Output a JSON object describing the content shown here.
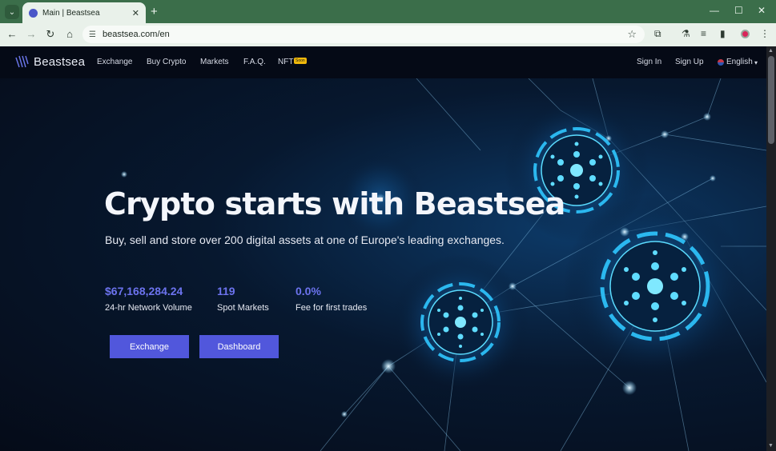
{
  "browser": {
    "tab_title": "Main | Beastsea",
    "new_tab": "+",
    "url": "beastsea.com/en",
    "controls": {
      "minimize": "—",
      "maximize": "☐",
      "close": "✕"
    }
  },
  "site": {
    "brand": "Beastsea",
    "nav": [
      "Exchange",
      "Buy Crypto",
      "Markets",
      "F.A.Q.",
      "NFT"
    ],
    "nft_badge": "Soon",
    "sign_in": "Sign In",
    "sign_up": "Sign Up",
    "language": "English"
  },
  "hero": {
    "title": "Crypto starts with Beastsea",
    "subtitle": "Buy, sell and store over 200 digital assets at one of Europe's leading exchanges.",
    "stats": [
      {
        "value": "$67,168,284.24",
        "label": "24-hr Network Volume"
      },
      {
        "value": "119",
        "label": "Spot Markets"
      },
      {
        "value": "0.0%",
        "label": "Fee for first trades"
      }
    ],
    "buttons": {
      "exchange": "Exchange",
      "dashboard": "Dashboard"
    }
  },
  "colors": {
    "accent": "#5157dc",
    "stat_accent": "#6c73ee",
    "browser_frame": "#3b6e4a",
    "nft_badge": "#f0b90b",
    "glow": "#2fc7ff"
  },
  "icons": [
    "tab-menu-icon",
    "close-icon",
    "back-icon",
    "forward-icon",
    "reload-icon",
    "home-icon",
    "site-info-icon",
    "star-icon",
    "extensions-icon",
    "labs-icon",
    "reading-list-icon",
    "side-panel-icon",
    "menu-icon",
    "chevron-down-icon"
  ]
}
